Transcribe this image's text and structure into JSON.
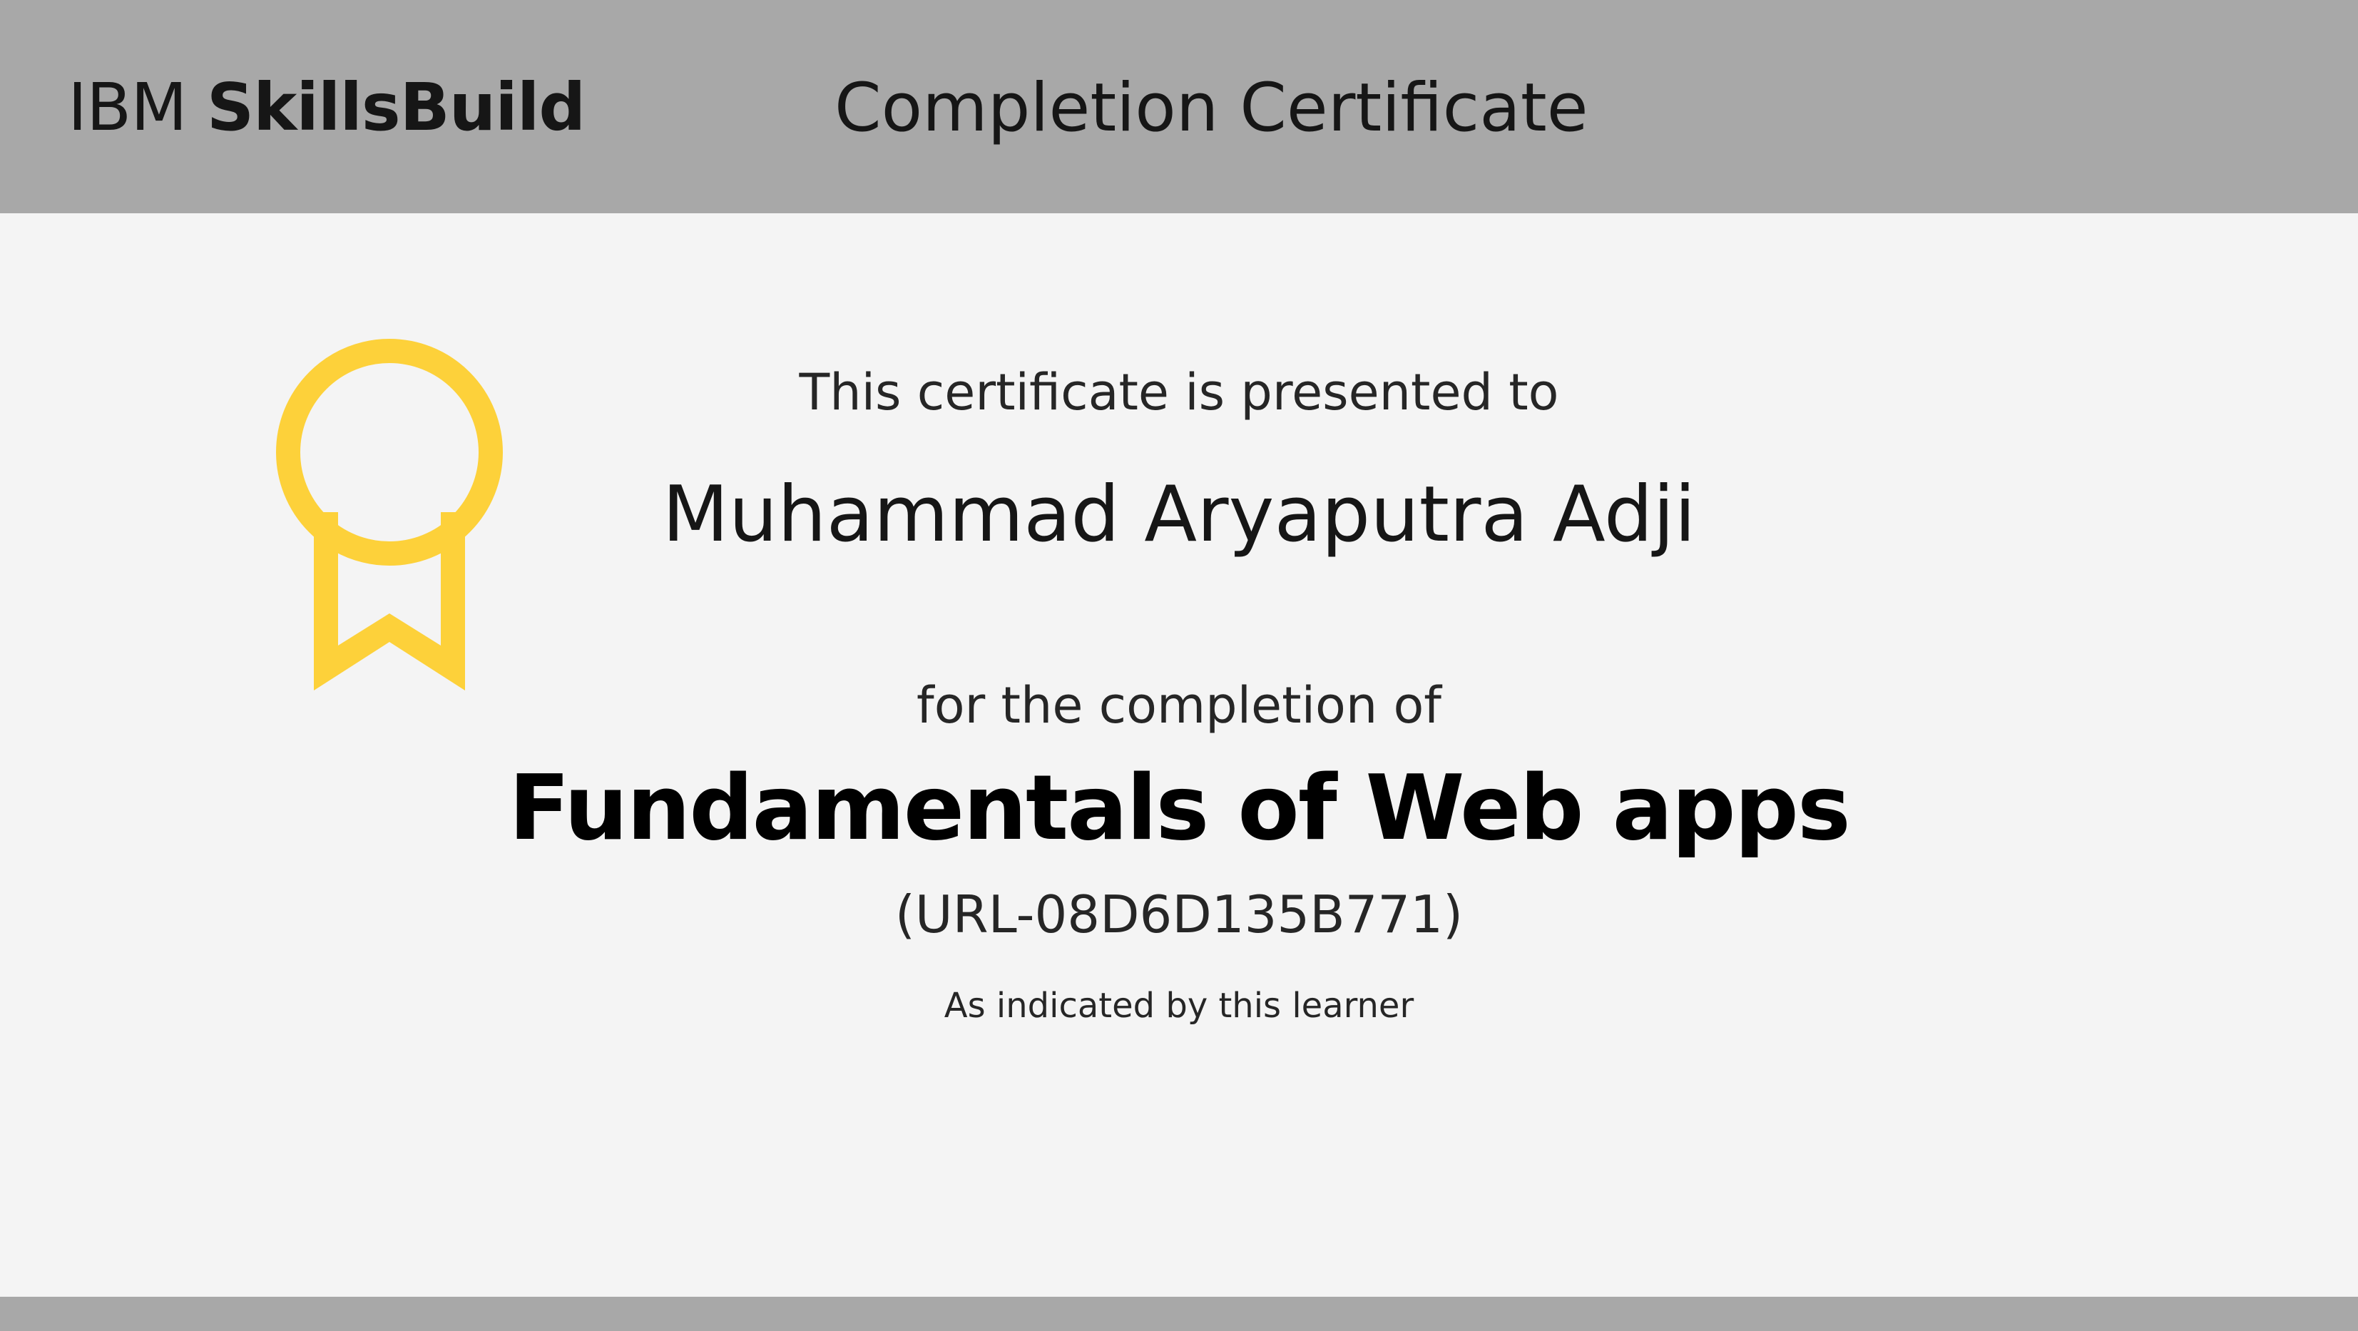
{
  "header": {
    "brand_prefix": "IBM",
    "brand_product": "SkillsBuild",
    "title": "Completion Certificate"
  },
  "certificate": {
    "presented_text": "This certificate is presented to",
    "recipient_name": "Muhammad Aryaputra Adji",
    "completion_text": "for the completion of",
    "course_title": "Fundamentals of Web apps",
    "course_code": "(URL-08D6D135B771)",
    "note": "As indicated by this learner"
  },
  "icons": {
    "medal": "award-ribbon-icon"
  },
  "colors": {
    "header_bg": "#a8a8a8",
    "page_bg": "#f4f4f4",
    "medal": "#fdd13a",
    "text": "#161616"
  }
}
